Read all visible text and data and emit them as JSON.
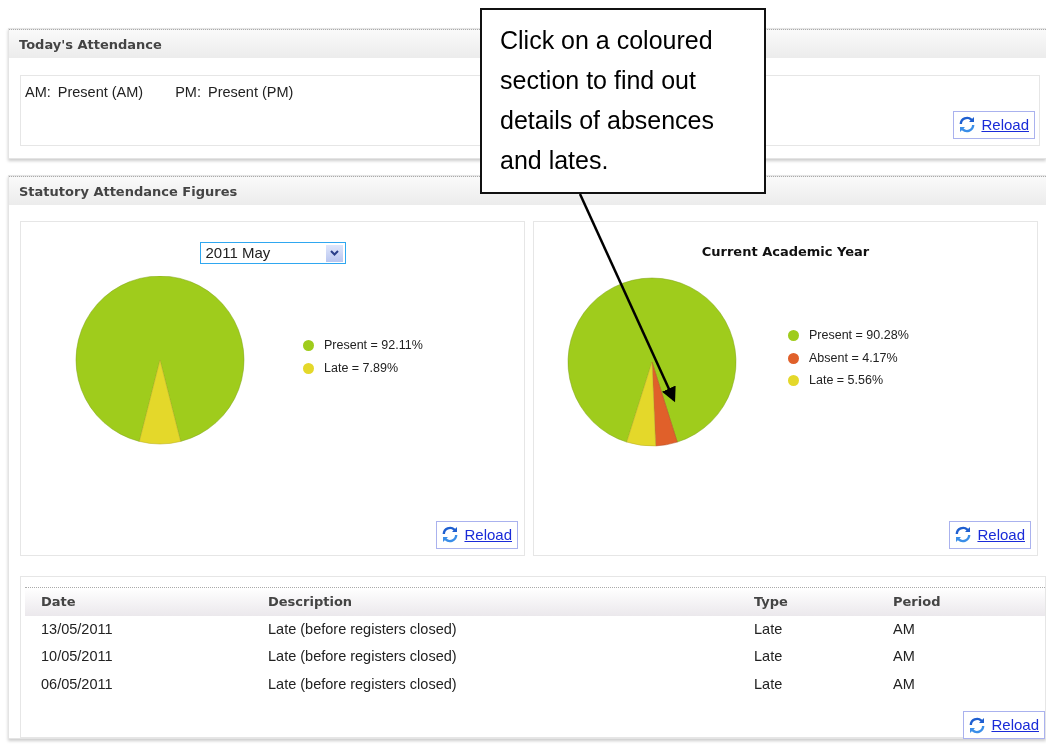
{
  "today": {
    "title": "Today's Attendance",
    "am_label": "AM:",
    "am_value": "Present (AM)",
    "pm_label": "PM:",
    "pm_value": "Present (PM)",
    "reload": "Reload"
  },
  "statutory": {
    "title": "Statutory Attendance Figures",
    "month_chart": {
      "select_value": "2011 May",
      "reload": "Reload",
      "legend": [
        {
          "value": "= 92.11%",
          "color": "#9fcc1c"
        },
        {
          "value": "= 7.89%",
          "color": "#e4d82a"
        }
      ],
      "chart_data": {
        "type": "pie",
        "categories": [
          "Present",
          "Late"
        ],
        "values": [
          92.11,
          7.89
        ]
      }
    },
    "year_chart": {
      "reload": "Reload",
      "legend": [
        {
          "value": "= 90.28%",
          "color": "#9fcc1c"
        },
        {
          "value": "= 4.17%",
          "color": "#e0602a"
        },
        {
          "value": "= 5.56%",
          "color": "#e4d82a"
        }
      ],
      "chart_data": {
        "type": "pie",
        "title": "Current Academic Year",
        "categories": [
          "Present",
          "Absent",
          "Late"
        ],
        "values": [
          90.28,
          4.17,
          5.56
        ]
      }
    }
  },
  "table": {
    "columns": [
      "Date",
      "Description",
      "Type",
      "Period"
    ],
    "rows": [
      [
        "13/05/2011",
        "Late (before registers closed)",
        "Late",
        "AM"
      ],
      [
        "10/05/2011",
        "Late (before registers closed)",
        "Late",
        "AM"
      ],
      [
        "06/05/2011",
        "Late (before registers closed)",
        "Late",
        "AM"
      ]
    ],
    "reload": "Reload"
  },
  "callout": {
    "text": "Click on a coloured section to find out details of absences and lates."
  }
}
